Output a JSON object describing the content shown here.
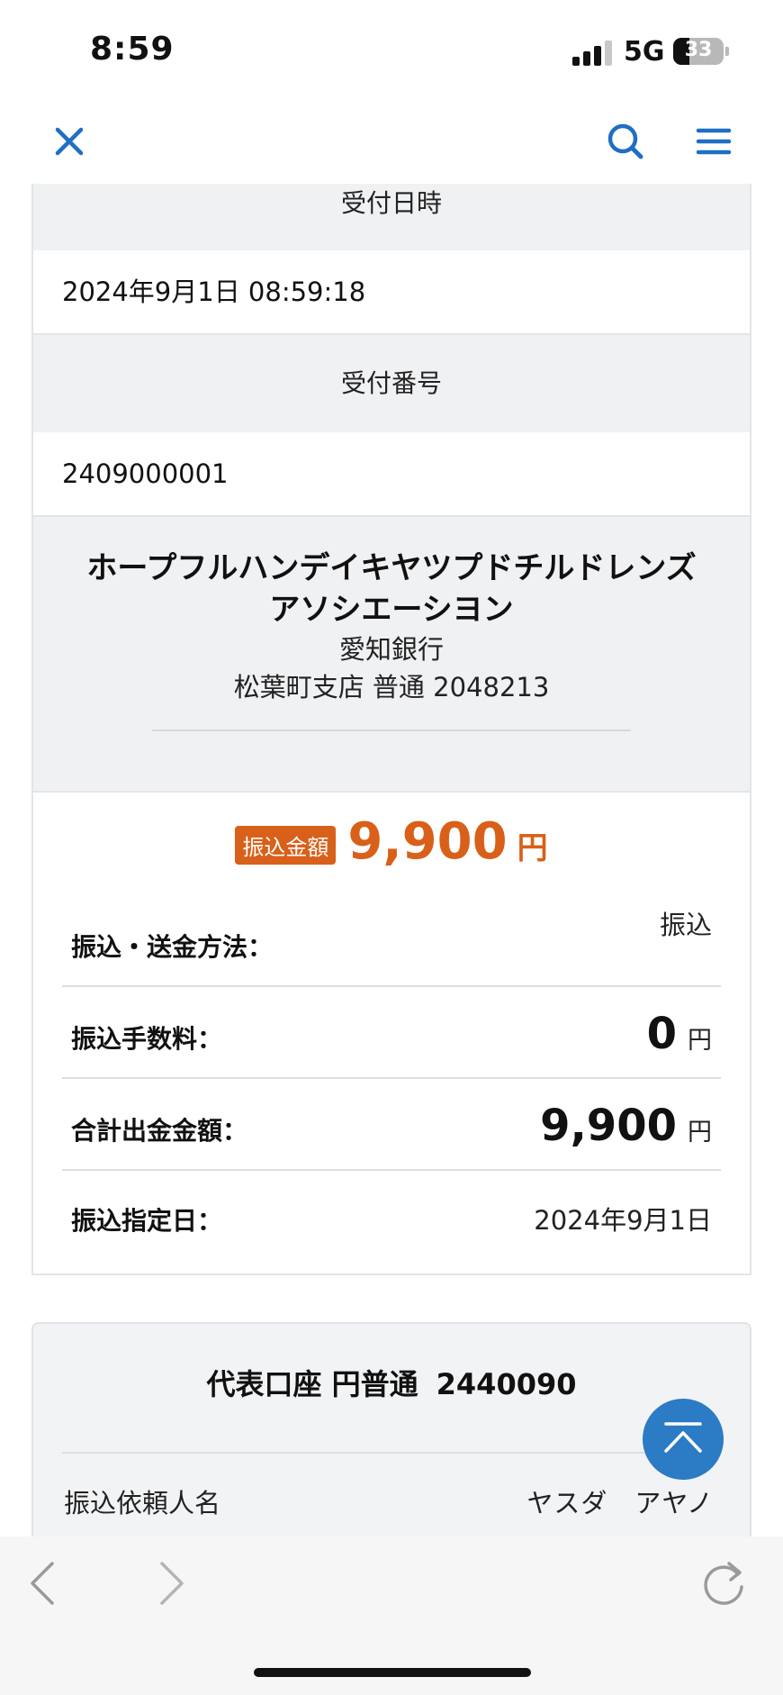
{
  "status_bar": {
    "time": "8:59",
    "network": "5G",
    "battery_percent": "33",
    "battery_level": 0.33
  },
  "nav": {
    "icons": [
      "close-icon",
      "search-icon",
      "menu-icon"
    ],
    "accent_color": "#1f6fc4"
  },
  "receipt": {
    "datetime_label": "受付日時",
    "datetime_value": "2024年9月1日 08:59:18",
    "number_label": "受付番号",
    "number_value": "2409000001"
  },
  "beneficiary": {
    "name_line1": "ホープフルハンデイキヤツプドチルドレンズ",
    "name_line2": "アソシエーシヨン",
    "bank": "愛知銀行",
    "branch_account": "松葉町支店 普通 2048213"
  },
  "transfer": {
    "amount_badge": "振込金額",
    "amount": "9,900",
    "amount_unit": "円",
    "accent_color": "#d9601a",
    "rows": [
      {
        "label": "振込・送金方法：",
        "value": "振込"
      },
      {
        "label": "振込手数料：",
        "value": "0",
        "unit": "円"
      },
      {
        "label": "合計出金金額：",
        "value": "9,900",
        "unit": "円"
      },
      {
        "label": "振込指定日：",
        "value": "2024年9月1日"
      }
    ]
  },
  "account": {
    "title": "代表口座 円普通",
    "number": "2440090",
    "requester_label": "振込依頼人名",
    "requester_value": "ヤスダ　アヤノ"
  },
  "browser_bar": {
    "icons": [
      "back-icon",
      "forward-icon",
      "reload-icon"
    ]
  }
}
